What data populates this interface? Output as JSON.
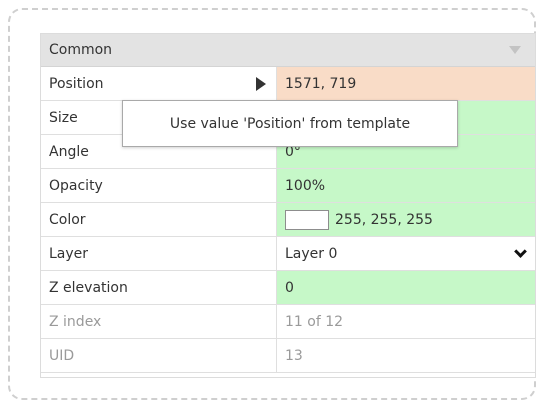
{
  "panel": {
    "group_title": "Common",
    "rows": [
      {
        "label": "Position",
        "value": "1571, 719",
        "state": "orange",
        "has_expand_arrow": true
      },
      {
        "label": "Size",
        "value": "",
        "state": "green"
      },
      {
        "label": "Angle",
        "value": "0°",
        "state": "green"
      },
      {
        "label": "Opacity",
        "value": "100%",
        "state": "green"
      },
      {
        "label": "Color",
        "value": "255, 255, 255",
        "state": "green",
        "swatch_color": "#ffffff"
      },
      {
        "label": "Layer",
        "value": "Layer 0",
        "state": "white",
        "has_dropdown": true
      },
      {
        "label": "Z elevation",
        "value": "0",
        "state": "green"
      },
      {
        "label": "Z index",
        "value": "11 of 12",
        "state": "disabled"
      },
      {
        "label": "UID",
        "value": "13",
        "state": "disabled"
      }
    ]
  },
  "tooltip": {
    "text": "Use value 'Position' from template"
  },
  "colors": {
    "header_bg": "#e3e3e3",
    "orange": "#f9dcc7",
    "green": "#c6f8c8",
    "border": "#dfdfdf",
    "disabled_text": "#9a9a9a"
  },
  "icons": {
    "collapse": "chevron-down-icon",
    "expand": "caret-right-icon",
    "dropdown": "chevron-down-icon"
  }
}
